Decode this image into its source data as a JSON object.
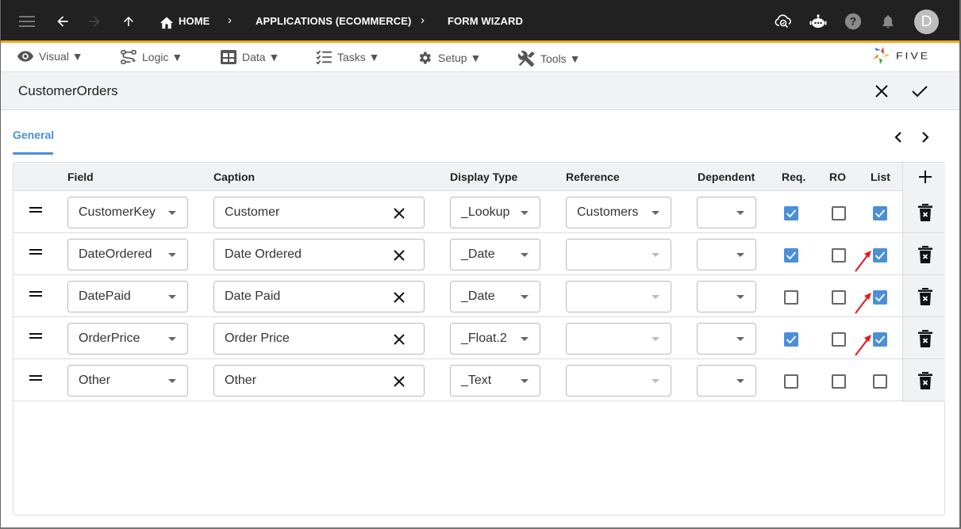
{
  "topbar": {
    "icons": [
      "menu-icon",
      "back-arrow-icon",
      "forward-arrow-icon",
      "up-arrow-icon"
    ],
    "breadcrumb": [
      {
        "label": "HOME",
        "icon": "home-icon"
      },
      {
        "label": "APPLICATIONS (ECOMMERCE)"
      },
      {
        "label": "FORM WIZARD"
      }
    ],
    "right_icons": [
      "cloud-search-icon",
      "chatbot-icon",
      "help-icon",
      "bell-icon"
    ],
    "avatar_initial": "D"
  },
  "menubar": {
    "items": [
      {
        "label": "Visual ▼",
        "icon": "eye-icon"
      },
      {
        "label": "Logic ▼",
        "icon": "logic-flow-icon"
      },
      {
        "label": "Data ▼",
        "icon": "table-icon"
      },
      {
        "label": "Tasks ▼",
        "icon": "checklist-icon"
      },
      {
        "label": "Setup ▼",
        "icon": "gear-icon"
      },
      {
        "label": "Tools ▼",
        "icon": "tools-icon"
      }
    ],
    "logo_text": "FIVE"
  },
  "form": {
    "title": "CustomerOrders",
    "cancel_icon": "close-icon",
    "confirm_icon": "check-icon"
  },
  "tabs": [
    {
      "label": "General",
      "active": true
    }
  ],
  "table": {
    "columns": [
      "Field",
      "Caption",
      "Display Type",
      "Reference",
      "Dependent",
      "Req.",
      "RO",
      "List"
    ],
    "rows": [
      {
        "field": "CustomerKey",
        "caption": "Customer",
        "display_type": "_Lookup",
        "reference": "Customers",
        "dependent": "",
        "req": true,
        "ro": false,
        "list": true,
        "annotated": false
      },
      {
        "field": "DateOrdered",
        "caption": "Date Ordered",
        "display_type": "_Date",
        "reference": "",
        "dependent": "",
        "req": true,
        "ro": false,
        "list": true,
        "annotated": true
      },
      {
        "field": "DatePaid",
        "caption": "Date Paid",
        "display_type": "_Date",
        "reference": "",
        "dependent": "",
        "req": false,
        "ro": false,
        "list": true,
        "annotated": true
      },
      {
        "field": "OrderPrice",
        "caption": "Order Price",
        "display_type": "_Float.2",
        "reference": "",
        "dependent": "",
        "req": true,
        "ro": false,
        "list": true,
        "annotated": true
      },
      {
        "field": "Other",
        "caption": "Other",
        "display_type": "_Text",
        "reference": "",
        "dependent": "",
        "req": false,
        "ro": false,
        "list": false,
        "annotated": false
      }
    ]
  },
  "colors": {
    "accent": "#4a8fd8",
    "topbar_bg": "#212121",
    "topbar_border": "#f0a81c",
    "annotation_arrow": "#e8141b"
  }
}
